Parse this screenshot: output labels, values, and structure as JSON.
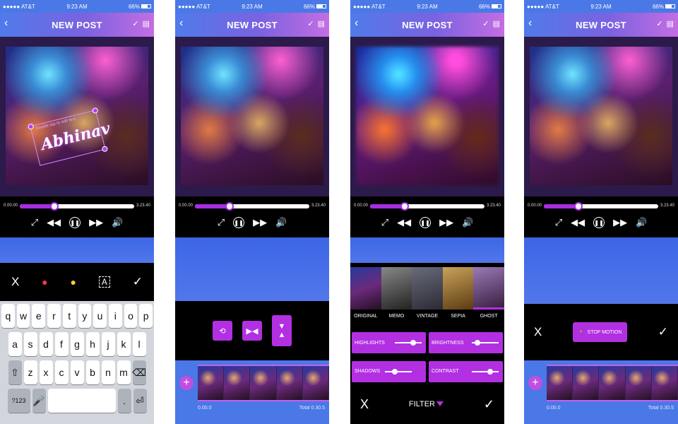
{
  "status": {
    "carrier": "●●●●● AT&T",
    "time": "9:23 AM",
    "battery": "66%"
  },
  "nav": {
    "title": "NEW POST",
    "back": "‹",
    "check": "✓"
  },
  "player": {
    "start": "0.00.00",
    "end": "3.23.40",
    "progress": 0.3
  },
  "sticker": {
    "hint": "Double tap to edit text",
    "name": "Abhinav"
  },
  "editor_tools": {
    "close": "X",
    "confirm": "✓"
  },
  "keyboard": {
    "row1": [
      "q",
      "w",
      "e",
      "r",
      "t",
      "y",
      "u",
      "i",
      "o",
      "p"
    ],
    "row2": [
      "a",
      "s",
      "d",
      "f",
      "g",
      "h",
      "j",
      "k",
      "l"
    ],
    "row3": [
      "z",
      "x",
      "c",
      "v",
      "b",
      "n",
      "m"
    ],
    "numbers": "?123"
  },
  "timeline": {
    "plus": "+",
    "start": "0.00.0",
    "total": "Total 0.30.5"
  },
  "filters": {
    "items": [
      "ORIGINAL",
      "MEMO",
      "VINTAGE",
      "SEPIA",
      "GHOST"
    ],
    "sliders": [
      "HIGHLIGHTS",
      "BRIGHTNESS",
      "SHADOWS",
      "CONTRAST"
    ],
    "label": "FILTER",
    "close": "X",
    "confirm": "✓"
  },
  "motion": {
    "button": "STOP MOTION",
    "close": "X",
    "confirm": "✓"
  },
  "colors": {
    "accent": "#b230e2",
    "bar": "#4a78e6"
  }
}
